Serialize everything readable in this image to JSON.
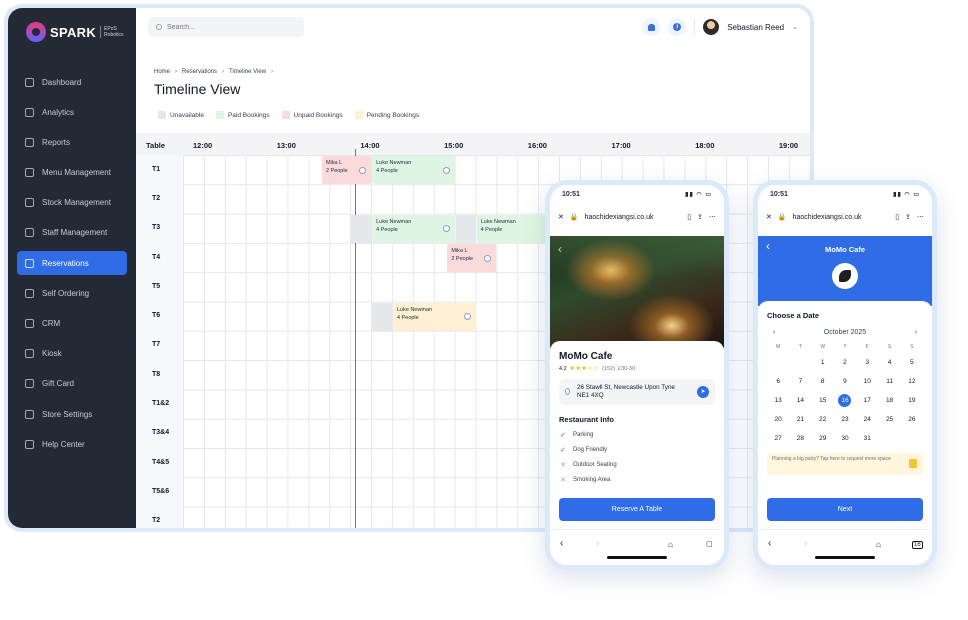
{
  "brand": {
    "name": "SPARK",
    "sub": "EPoS Robotics"
  },
  "sidebar": {
    "items": [
      {
        "label": "Dashboard",
        "active": false
      },
      {
        "label": "Analytics",
        "active": false
      },
      {
        "label": "Reports",
        "active": false
      },
      {
        "label": "Menu Management",
        "active": false
      },
      {
        "label": "Stock Management",
        "active": false
      },
      {
        "label": "Staff Management",
        "active": false
      },
      {
        "label": "Reservations",
        "active": true
      },
      {
        "label": "Self Ordering",
        "active": false
      },
      {
        "label": "CRM",
        "active": false
      },
      {
        "label": "Kiosk",
        "active": false
      },
      {
        "label": "Gift Card",
        "active": false
      },
      {
        "label": "Store Settings",
        "active": false
      },
      {
        "label": "Help Center",
        "active": false
      }
    ]
  },
  "header": {
    "search_placeholder": "Search...",
    "user_name": "Sebastian Reed"
  },
  "breadcrumb": [
    "Home",
    "Reservations",
    "Timeline View"
  ],
  "page_title": "Timeline View",
  "legend": [
    {
      "label": "Unavailable",
      "color": "#e5e7eb"
    },
    {
      "label": "Paid Bookings",
      "color": "#dff5e3"
    },
    {
      "label": "Unpaid Bookings",
      "color": "#fbdada"
    },
    {
      "label": "Pending Bookings",
      "color": "#fdf0d2"
    }
  ],
  "timeline": {
    "column_header": "Table",
    "times": [
      "12:00",
      "13:00",
      "14:00",
      "15:00",
      "16:00",
      "17:00",
      "18:00",
      "19:00"
    ],
    "tables": [
      "T1",
      "T2",
      "T3",
      "T4",
      "T5",
      "T6",
      "T7",
      "T8",
      "T1&2",
      "T3&4",
      "T4&5",
      "T5&6",
      "T2"
    ],
    "bookings": [
      {
        "name": "Mika L",
        "people": "2 People",
        "status": "unpaid"
      },
      {
        "name": "Luke Newman",
        "people": "4 People",
        "status": "paid"
      },
      {
        "name": "Luke Newman",
        "people": "4 People",
        "status": "paid"
      },
      {
        "name": "Luke Newman",
        "people": "4 People",
        "status": "paid"
      },
      {
        "name": "Mika L",
        "people": "2 People",
        "status": "unpaid"
      },
      {
        "name": "Luke Newman",
        "people": "4 People",
        "status": "pending"
      }
    ]
  },
  "phone1": {
    "time": "10:51",
    "url": "haochidexiangsi.co.uk",
    "cafe_name": "MoMo Cafe",
    "rating": "4.2",
    "reviews": "(152)",
    "price": "£30-30",
    "address_line1": "26 Stawll St, Newcastle Upon Tyne",
    "address_line2": "NE1 4XQ",
    "info_title": "Restaurant Info",
    "amenities": [
      {
        "label": "Parking",
        "available": true
      },
      {
        "label": "Dog Friendly",
        "available": true
      },
      {
        "label": "Outdoor Seating",
        "available": false
      },
      {
        "label": "Smoking Area",
        "available": false
      }
    ],
    "cta": "Reserve A Table"
  },
  "phone2": {
    "time": "10:51",
    "url": "haochidexiangsi.co.uk",
    "cafe_name": "MoMo Cafe",
    "choose_title": "Choose a Date",
    "month": "October 2025",
    "weekdays": [
      "M",
      "T",
      "W",
      "T",
      "F",
      "S",
      "S"
    ],
    "days": [
      "",
      "",
      "1",
      "2",
      "3",
      "4",
      "5",
      "6",
      "7",
      "8",
      "9",
      "10",
      "11",
      "12",
      "13",
      "14",
      "15",
      "16",
      "17",
      "18",
      "19",
      "20",
      "21",
      "22",
      "23",
      "24",
      "25",
      "26",
      "27",
      "28",
      "29",
      "30",
      "31",
      "",
      ""
    ],
    "selected_day": "16",
    "party_note": "Planning a big party? Tap here to request more space",
    "cta": "Next",
    "tab_count": "16"
  },
  "colors": {
    "accent": "#2f6ce6",
    "sidebar_bg": "#242a35",
    "now_line": "#d9455f"
  }
}
